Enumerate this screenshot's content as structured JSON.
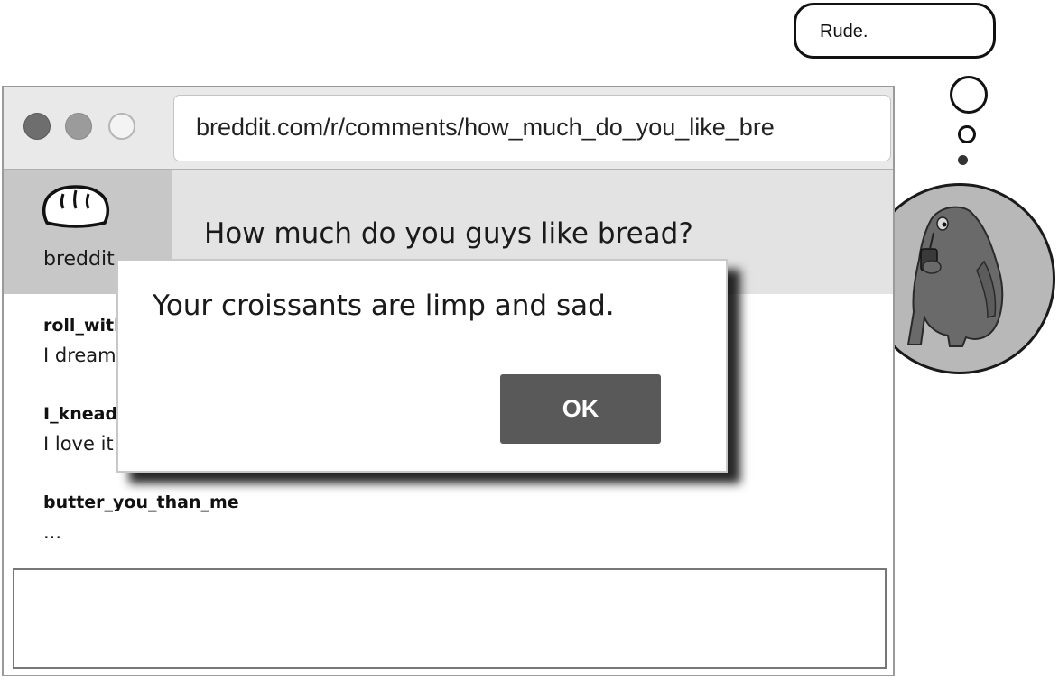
{
  "thought": {
    "text": "Rude."
  },
  "browser": {
    "address": "breddit.com/r/comments/how_much_do_you_like_bre"
  },
  "site": {
    "logo_text": "breddit",
    "post_title": "How much do you guys like bread?"
  },
  "comments": [
    {
      "user": "roll_with_it",
      "text": "I dream about bread"
    },
    {
      "user": "I_knead_bread",
      "text": "I love it"
    },
    {
      "user": "butter_you_than_me",
      "text": "..."
    }
  ],
  "alert": {
    "message": "Your croissants are limp and sad.",
    "ok_label": "OK"
  },
  "icons": {
    "bread": "bread-icon",
    "avatar": "monster-avatar"
  },
  "colors": {
    "toolbar": "#e9e9e9",
    "header": "#e3e3e3",
    "logo_panel": "#c7c7c7",
    "ok_button": "#595959",
    "avatar_bg": "#b8b8b8"
  }
}
